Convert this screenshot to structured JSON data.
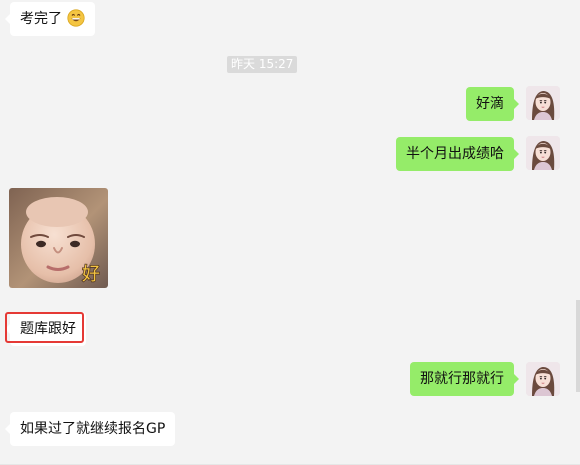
{
  "timestamp": "昨天 15:27",
  "messages": {
    "m1": {
      "text": "考完了",
      "emoji": "grinning-face-emoji"
    },
    "m2": {
      "text": "好滴"
    },
    "m3": {
      "text": "半个月出成绩哈"
    },
    "m4": {
      "text": "题库跟好"
    },
    "m5": {
      "text": "那就行那就行"
    },
    "m6": {
      "text": "如果过了就继续报名GP"
    }
  },
  "sticker": {
    "caption": "好",
    "icon": "baby-face-sticker"
  },
  "avatars": {
    "self": {
      "icon": "woman-avatar-icon"
    }
  },
  "colors": {
    "background": "#f3f3f3",
    "bubble_in": "#ffffff",
    "bubble_out": "#95ec69",
    "timestamp_bg": "#dadada",
    "highlight": "#e53935"
  }
}
